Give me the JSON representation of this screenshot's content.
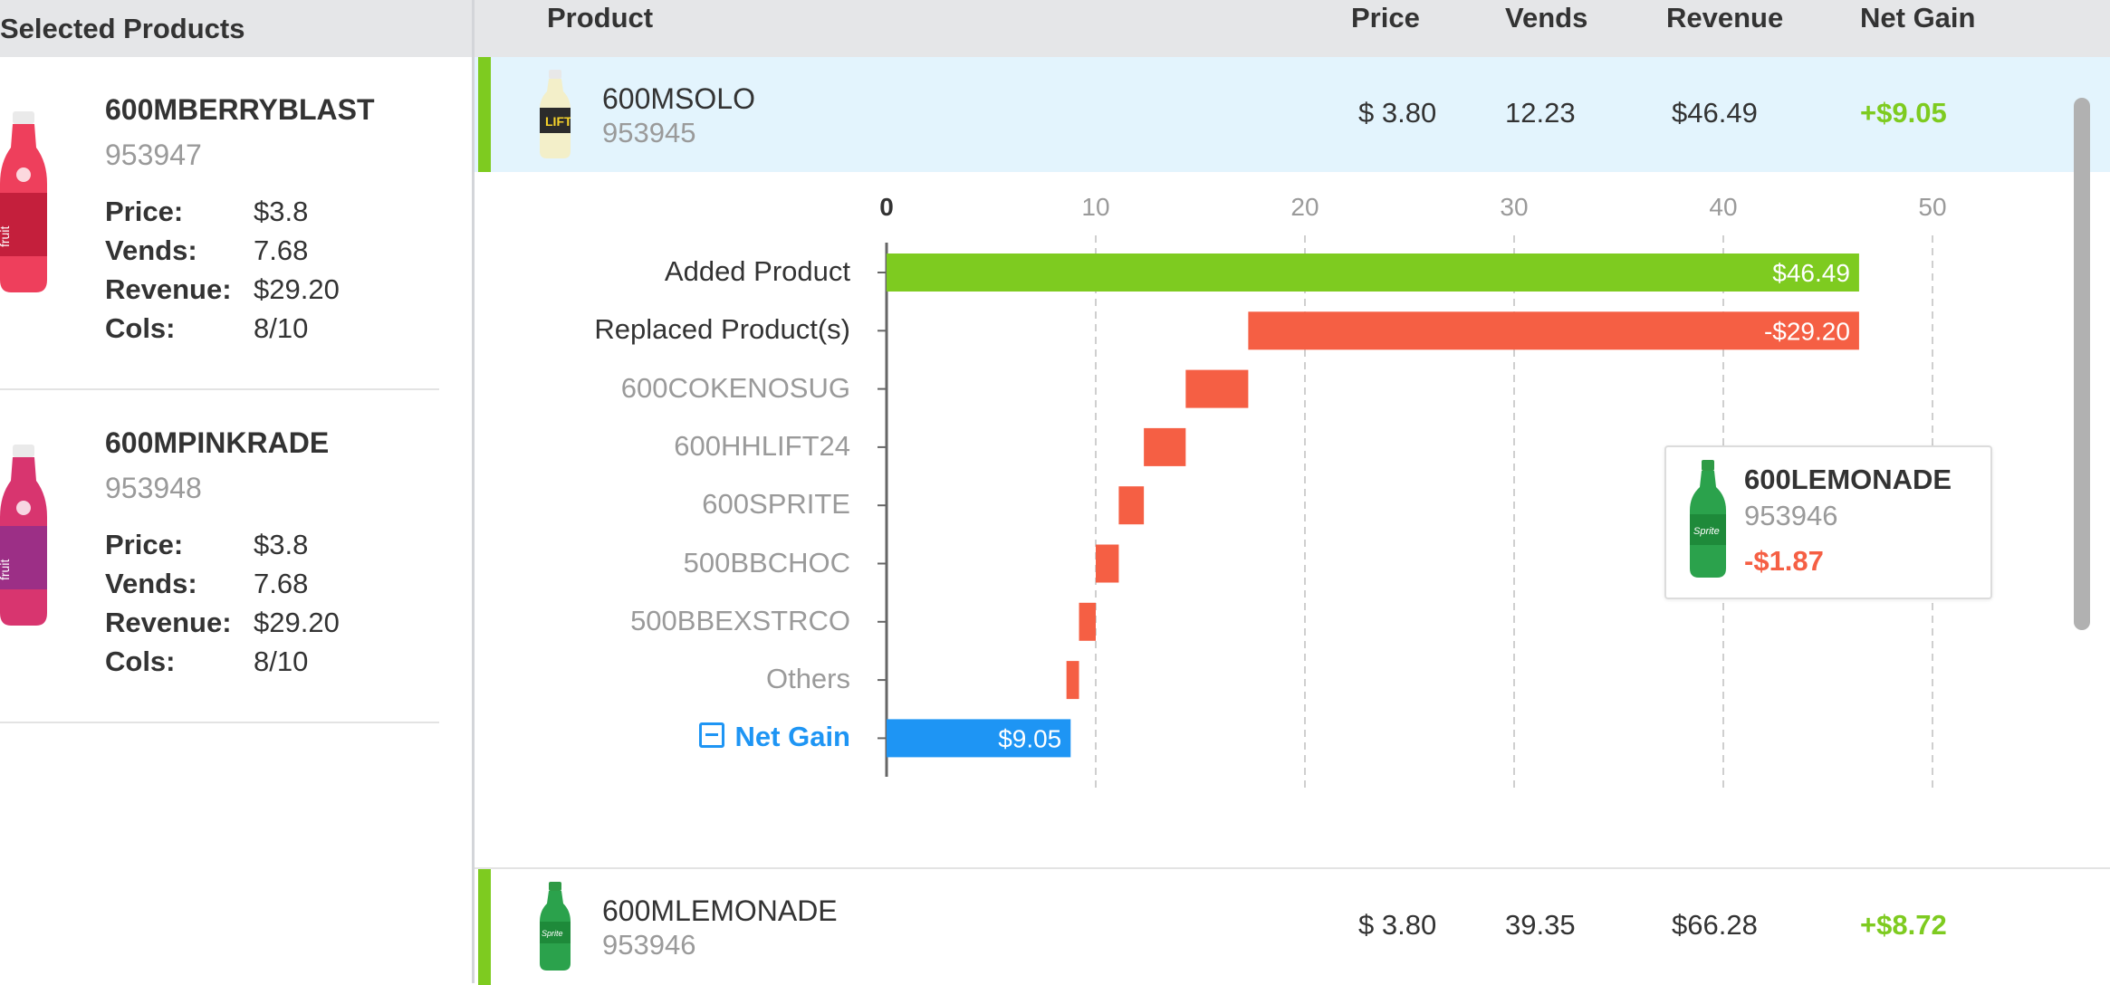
{
  "left_panel": {
    "title": "Selected Products",
    "cards": [
      {
        "name": "600MBERRYBLAST",
        "id": "953947",
        "stats": [
          {
            "label": "Price:",
            "value": "$3.8"
          },
          {
            "label": "Vends:",
            "value": "7.68"
          },
          {
            "label": "Revenue:",
            "value": "$29.20"
          },
          {
            "label": "Cols:",
            "value": "8/10"
          }
        ],
        "bottle_icon": "berry-bottle-icon"
      },
      {
        "name": "600MPINKRADE",
        "id": "953948",
        "stats": [
          {
            "label": "Price:",
            "value": "$3.8"
          },
          {
            "label": "Vends:",
            "value": "7.68"
          },
          {
            "label": "Revenue:",
            "value": "$29.20"
          },
          {
            "label": "Cols:",
            "value": "8/10"
          }
        ],
        "bottle_icon": "pink-bottle-icon"
      }
    ]
  },
  "table": {
    "headers": {
      "product": "Product",
      "price": "Price",
      "vends": "Vends",
      "revenue": "Revenue",
      "net_gain": "Net Gain"
    },
    "rows": [
      {
        "name": "600MSOLO",
        "id": "953945",
        "price": "$ 3.80",
        "vends": "12.23",
        "revenue": "$46.49",
        "net_gain": "+$9.05",
        "bottle_icon": "solo-bottle-icon"
      },
      {
        "name": "600MLEMONADE",
        "id": "953946",
        "price": "$ 3.80",
        "vends": "39.35",
        "revenue": "$66.28",
        "net_gain": "+$8.72",
        "bottle_icon": "sprite-bottle-icon"
      }
    ]
  },
  "chart_data": {
    "type": "bar",
    "orientation": "waterfall-horizontal",
    "xlim": [
      0,
      50
    ],
    "xticks": [
      "0",
      "10",
      "20",
      "30",
      "40",
      "50"
    ],
    "grid": true,
    "categories": [
      "Added Product",
      "Replaced Product(s)",
      "600COKENOSUG",
      "600HHLIFT24",
      "600SPRITE",
      "500BBCHOC",
      "500BBEXSTRCO",
      "Others",
      "Net Gain"
    ],
    "bars": [
      {
        "category": "Added Product",
        "start": 0,
        "end": 46.49,
        "label": "$46.49",
        "color": "#7ecb20"
      },
      {
        "category": "Replaced Product(s)",
        "start": 17.29,
        "end": 46.49,
        "label": "-$29.20",
        "color": "#f55f44"
      },
      {
        "category": "600COKENOSUG",
        "start": 14.3,
        "end": 17.29,
        "label": "",
        "color": "#f55f44"
      },
      {
        "category": "600HHLIFT24",
        "start": 12.3,
        "end": 14.3,
        "label": "",
        "color": "#f55f44"
      },
      {
        "category": "600SPRITE",
        "start": 11.1,
        "end": 12.3,
        "label": "",
        "color": "#f55f44"
      },
      {
        "category": "500BBCHOC",
        "start": 10.0,
        "end": 11.1,
        "label": "",
        "color": "#f55f44"
      },
      {
        "category": "500BBEXSTRCO",
        "start": 9.2,
        "end": 10.0,
        "label": "",
        "color": "#f55f44"
      },
      {
        "category": "Others",
        "start": 8.6,
        "end": 9.2,
        "label": "",
        "color": "#f55f44"
      },
      {
        "category": "Net Gain",
        "start": 0,
        "end": 8.8,
        "label": "$9.05",
        "color": "#1e95f4"
      }
    ],
    "label_colors": {
      "primary": "#333333",
      "secondary": "#9a9a9a",
      "net_gain": "#1e95f4"
    }
  },
  "tooltip": {
    "name": "600LEMONADE",
    "id": "953946",
    "value": "-$1.87",
    "bottle_icon": "sprite-bottle-icon"
  },
  "colors": {
    "accent_green": "#7ecb20",
    "loss_red": "#f55f44",
    "net_blue": "#1e95f4",
    "highlight_row": "#e3f4fd"
  }
}
